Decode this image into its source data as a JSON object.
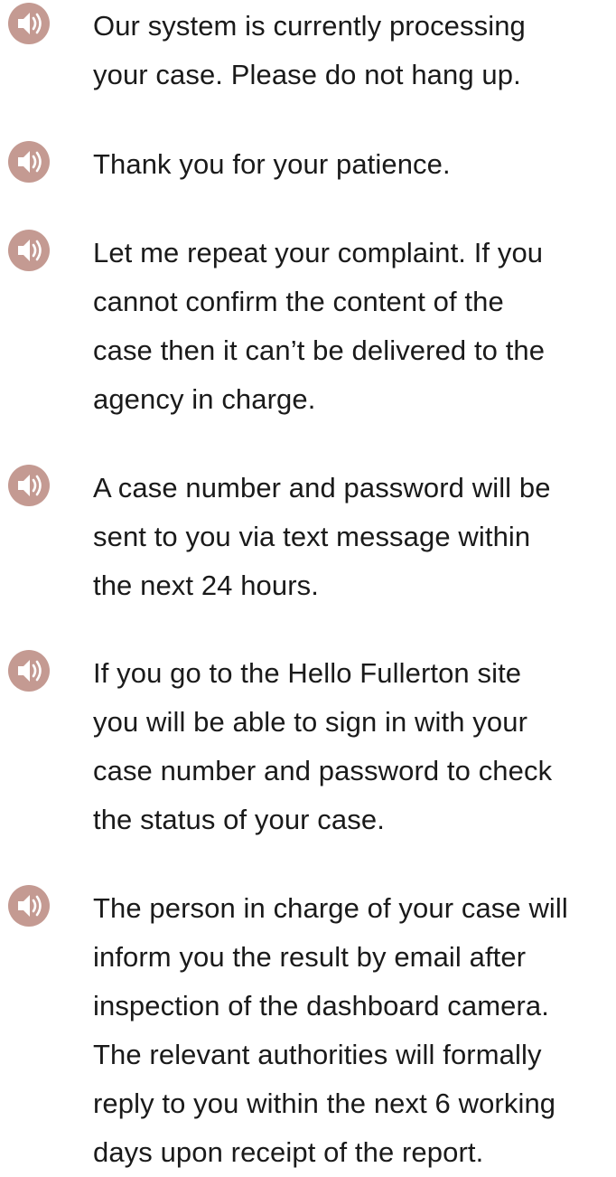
{
  "icon_color": "#C49A92",
  "messages": [
    {
      "icon": "speaker-icon",
      "text": "Our system is currently processing\nyour case. Please do not hang up."
    },
    {
      "icon": "speaker-icon",
      "text": "Thank you for your patience."
    },
    {
      "icon": "speaker-icon",
      "text": "Let me repeat your complaint. If you\ncannot confirm the content of the\ncase then it can’t be delivered to the\nagency in charge."
    },
    {
      "icon": "speaker-icon",
      "text": "A case number and password will be\nsent to you via text message within\nthe next 24 hours."
    },
    {
      "icon": "speaker-icon",
      "text": "If you go to the Hello Fullerton site\nyou will be able to sign in with your\ncase number and password to check\nthe status of your case."
    },
    {
      "icon": "speaker-icon",
      "text": "The person in charge of your case will\ninform you the result by email after\ninspection of the dashboard camera.\nThe relevant authorities will formally\nreply to you within the next 6 working\ndays upon receipt of the report."
    }
  ]
}
